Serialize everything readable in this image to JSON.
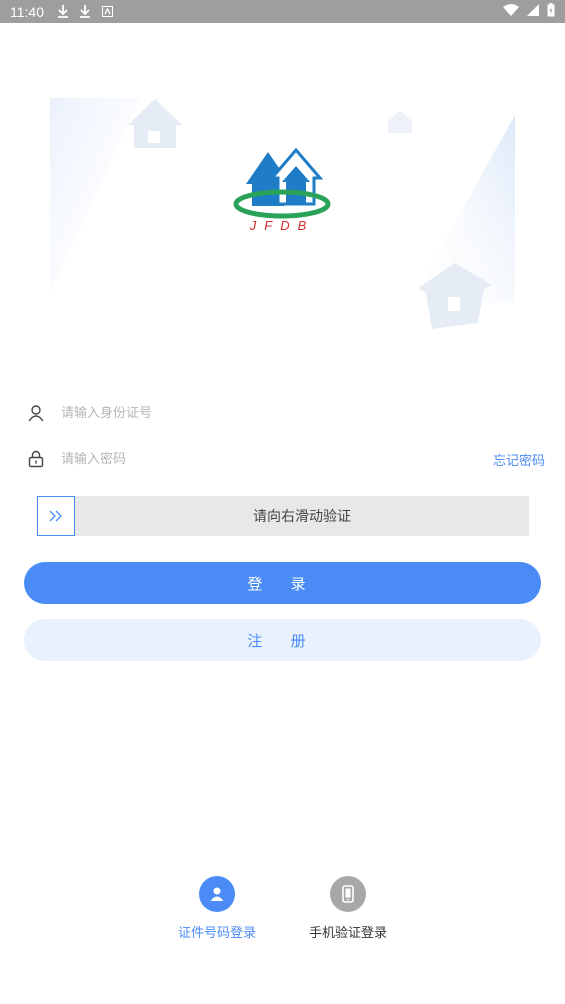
{
  "status_bar": {
    "time": "11:40",
    "left_icons": [
      "download-icon",
      "download-icon",
      "app-notification-icon"
    ],
    "right_icons": [
      "wifi-icon",
      "signal-icon",
      "battery-icon"
    ]
  },
  "logo": {
    "text": "JFDB",
    "colors": {
      "house": "#1f7cc7",
      "ring": "#2aa35a",
      "text": "#d32f2f"
    }
  },
  "form": {
    "id_placeholder": "请输入身份证号",
    "password_placeholder": "请输入密码",
    "forgot_password": "忘记密码"
  },
  "slider": {
    "text": "请向右滑动验证",
    "handle_icon": "double-chevron-right-icon"
  },
  "buttons": {
    "login": "登 录",
    "register": "注 册"
  },
  "login_options": {
    "id": {
      "label": "证件号码登录",
      "icon": "person-icon",
      "active": true
    },
    "phone": {
      "label": "手机验证登录",
      "icon": "phone-icon",
      "active": false
    }
  },
  "colors": {
    "accent": "#4a8bf5",
    "register_bg": "#e9f1fd",
    "slider_bg": "#e8e8e8",
    "status_bar": "#9e9e9e"
  }
}
